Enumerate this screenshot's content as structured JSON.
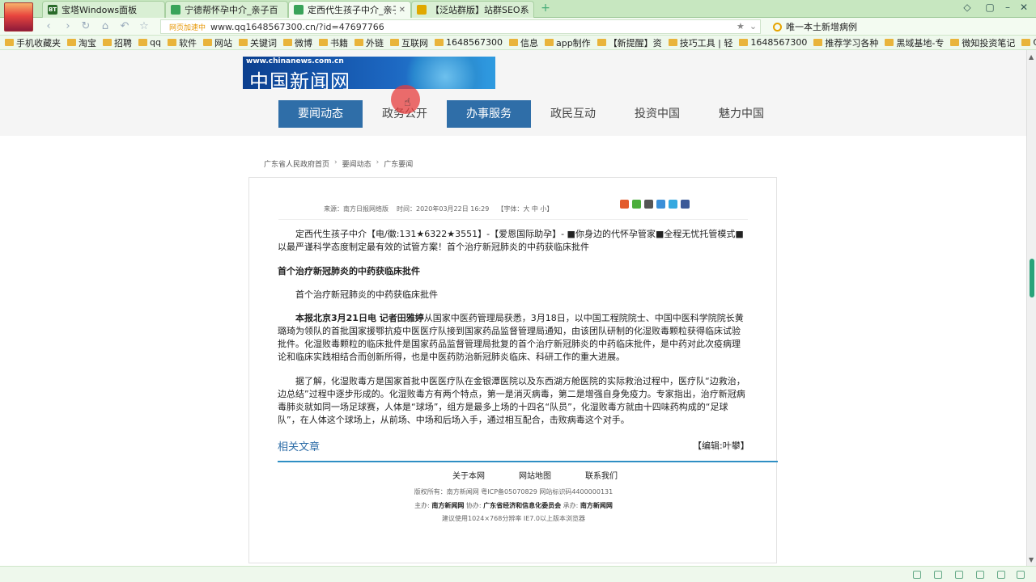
{
  "browser": {
    "tabs": [
      {
        "label": "宝塔Windows面板",
        "icon_color": "#2a6b2a",
        "icon_text": "BT"
      },
      {
        "label": "宁德帮怀孕中介_亲子百",
        "icon_color": "#3aa35a",
        "icon_text": ""
      },
      {
        "label": "定西代生孩子中介_亲子",
        "icon_color": "#3aa35a",
        "icon_text": ""
      },
      {
        "label": "【泛站群版】站群SEO系",
        "icon_color": "#e0a800",
        "icon_text": ""
      }
    ],
    "new_tab": "+",
    "window_controls": [
      "▢",
      "–",
      "▭",
      "✕"
    ],
    "address": {
      "secure_label": "网页加速中",
      "url": "www.qq1648567300.cn/?id=47697766"
    },
    "search_box": "唯一本土新增病例",
    "bookmarks": [
      "手机收藏夹",
      "淘宝",
      "招聘",
      "qq",
      "软件",
      "网站",
      "关键词",
      "微博",
      "书籍",
      "外链",
      "互联网",
      "1648567300",
      "信息",
      "app制作",
      "【新提醒】资",
      "技巧工具 | 轻",
      "1648567300",
      "推荐学习各种",
      "黑域基地-专",
      "微知投资笔记",
      "QiuQuan's"
    ]
  },
  "site": {
    "logo_url": "www.chinanews.com.cn",
    "logo_name": "中国新闻网",
    "menu": [
      {
        "label": "要闻动态",
        "active": true
      },
      {
        "label": "政务公开",
        "active": false
      },
      {
        "label": "办事服务",
        "active": true
      },
      {
        "label": "政民互动",
        "active": false
      },
      {
        "label": "投资中国",
        "active": false
      },
      {
        "label": "魅力中国",
        "active": false
      }
    ],
    "breadcrumb": [
      "广东省人民政府首页",
      "要闻动态",
      "广东要闻"
    ],
    "breadcrumb_sep": "›"
  },
  "article": {
    "source": "来源：南方日报网络版",
    "time": "时间：2020年03月22日 16:29",
    "font_size": "【字体：大 中 小】",
    "intro": "定西代生孩子中介【电/徽:131★6322★3551】-【爱恩国际助孕】- ■你身边的代怀孕管家■全程无忧托管模式■以最严谨科学态度制定最有效的试管方案！首个治疗新冠肺炎的中药获临床批件",
    "subhead": "首个治疗新冠肺炎的中药获临床批件",
    "sub_para": "首个治疗新冠肺炎的中药获临床批件",
    "p1_bold": "本报北京3月21日电 记者田雅婷",
    "p1_text": "从国家中医药管理局获悉，3月18日，以中国工程院院士、中国中医科学院院长黄璐琦为领队的首批国家援鄂抗疫中医医疗队接到国家药品监督管理局通知，由该团队研制的化湿败毒颗粒获得临床试验批件。化湿败毒颗粒的临床批件是国家药品监督管理局批复的首个治疗新冠肺炎的中药临床批件，是中药对此次疫病理论和临床实践相结合而创新所得，也是中医药防治新冠肺炎临床、科研工作的重大进展。",
    "p2": "据了解，化湿败毒方是国家首批中医医疗队在金银潭医院以及东西湖方舱医院的实际救治过程中，医疗队“边救治，边总结”过程中逐步形成的。化湿败毒方有两个特点，第一是消灭病毒，第二是增强自身免疫力。专家指出，治疗新冠病毒肺炎就如同一场足球赛，人体是“球场”，组方是最多上场的十四名“队员”，化湿败毒方就由十四味药构成的“足球队”，在人体这个球场上，从前场、中场和后场入手，通过相互配合，击败病毒这个对手。",
    "related": "相关文章",
    "editor": "【编辑:叶攀】"
  },
  "footer": {
    "links": [
      "关于本网",
      "网站地图",
      "联系我们"
    ],
    "copyright": "版权所有：南方新闻网  粤ICP备05070829  网站标识码4400000131",
    "host_label": "主办:",
    "host": "南方新闻网",
    "co_label": "协办:",
    "co": "广东省经济和信息化委员会",
    "undertake_label": "承办:",
    "undertake": "南方新闻网",
    "recommend": "建议使用1024×768分辨率 IE7.0以上版本浏览器"
  }
}
